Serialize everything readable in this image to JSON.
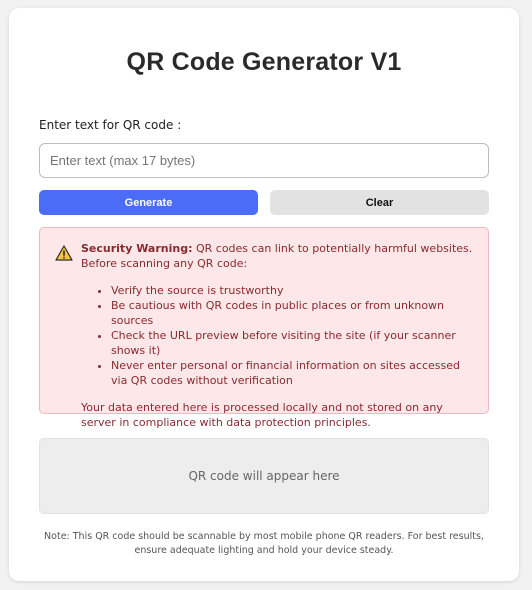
{
  "header": {
    "title": "QR Code Generator V1"
  },
  "form": {
    "label": "Enter text for QR code :",
    "input_value": "",
    "input_placeholder": "Enter text (max 17 bytes)",
    "generate_label": "Generate",
    "clear_label": "Clear"
  },
  "warning": {
    "icon": "warning-triangle-icon",
    "heading": "Security Warning:",
    "intro": "QR codes can link to potentially harmful websites. Before scanning any QR code:",
    "items": [
      "Verify the source is trustworthy",
      "Be cautious with QR codes in public places or from unknown sources",
      "Check the URL preview before visiting the site (if your scanner shows it)",
      "Never enter personal or financial information on sites accessed via QR codes without verification"
    ],
    "footer": "Your data entered here is processed locally and not stored on any server in compliance with data protection principles."
  },
  "qr": {
    "placeholder": "QR code will appear here"
  },
  "note": "Note: This QR code should be scannable by most mobile phone QR readers. For best results, ensure adequate lighting and hold your device steady.",
  "colors": {
    "accent": "#4a6cf7",
    "warning_bg": "#fde7e8",
    "warning_border": "#f2b7bd",
    "warning_text": "#8a2a2f"
  }
}
